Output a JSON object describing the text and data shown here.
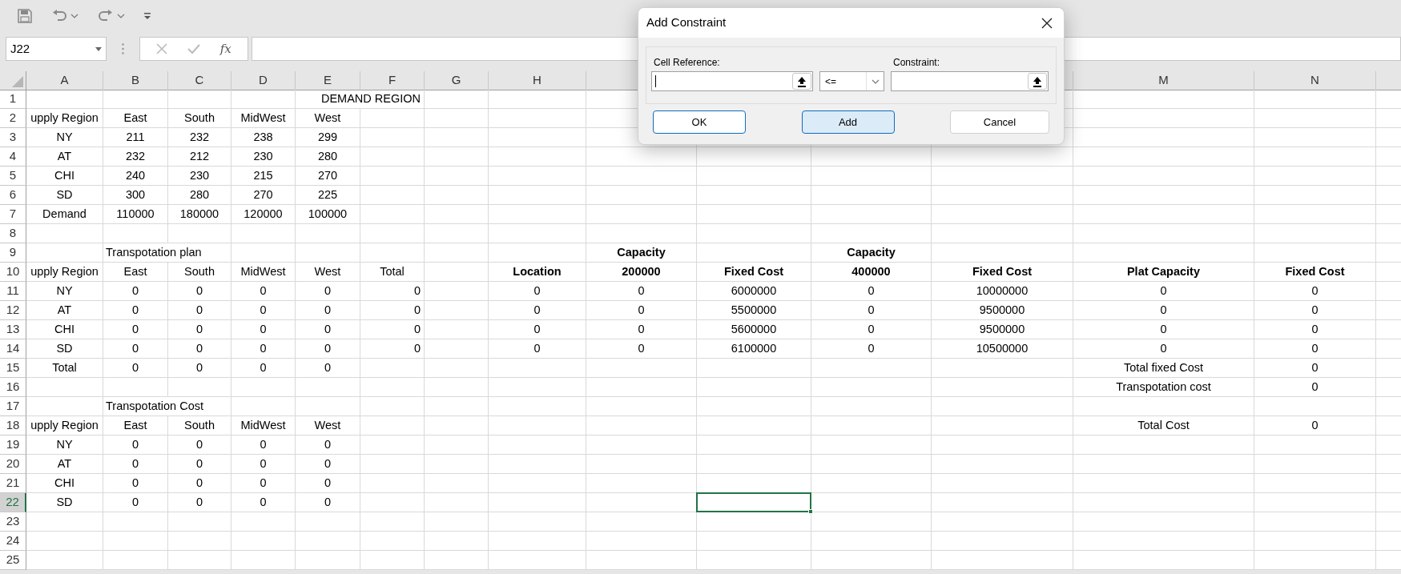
{
  "quick_access": {
    "undo_enabled": true,
    "redo_enabled": true
  },
  "formula_bar": {
    "name_box": "J22",
    "function_button": "fx"
  },
  "column_headers": [
    {
      "label": "A"
    },
    {
      "label": "B"
    },
    {
      "label": "C"
    },
    {
      "label": "D"
    },
    {
      "label": "E"
    },
    {
      "label": "F"
    },
    {
      "label": "G"
    },
    {
      "label": "H"
    },
    {
      "label": "M"
    },
    {
      "label": "N"
    }
  ],
  "rows": [
    {
      "label": "1",
      "selected": false,
      "cells": [
        {},
        {},
        {},
        {},
        {},
        {
          "text": "DEMAND REGION",
          "align_right": true,
          "overflows": true
        }
      ]
    },
    {
      "label": "2",
      "selected": false,
      "cells": [
        {
          "text": "upply Region"
        },
        {
          "text": "East"
        },
        {
          "text": "South"
        },
        {
          "text": "MidWest"
        },
        {
          "text": "West"
        }
      ]
    },
    {
      "label": "3",
      "selected": false,
      "cells": [
        {
          "text": "NY"
        },
        {
          "text": "211"
        },
        {
          "text": "232"
        },
        {
          "text": "238"
        },
        {
          "text": "299"
        }
      ]
    },
    {
      "label": "4",
      "selected": false,
      "cells": [
        {
          "text": "AT"
        },
        {
          "text": "232"
        },
        {
          "text": "212"
        },
        {
          "text": "230"
        },
        {
          "text": "280"
        }
      ]
    },
    {
      "label": "5",
      "selected": false,
      "cells": [
        {
          "text": "CHI"
        },
        {
          "text": "240"
        },
        {
          "text": "230"
        },
        {
          "text": "215"
        },
        {
          "text": "270"
        }
      ]
    },
    {
      "label": "6",
      "selected": false,
      "cells": [
        {
          "text": "SD"
        },
        {
          "text": "300"
        },
        {
          "text": "280"
        },
        {
          "text": "270"
        },
        {
          "text": "225"
        }
      ]
    },
    {
      "label": "7",
      "selected": false,
      "cells": [
        {
          "text": "Demand"
        },
        {
          "text": "110000"
        },
        {
          "text": "180000"
        },
        {
          "text": "120000"
        },
        {
          "text": "100000"
        }
      ]
    },
    {
      "label": "8",
      "selected": false,
      "cells": []
    },
    {
      "label": "9",
      "selected": false,
      "cells": [
        {},
        {
          "text": "Transpotation plan",
          "align_left": true,
          "overflows": true
        },
        {},
        {},
        {},
        {},
        {},
        {},
        {
          "text": "Capacity",
          "bold": true
        },
        {},
        {
          "text": "Capacity",
          "bold": true
        }
      ]
    },
    {
      "label": "10",
      "selected": false,
      "cells": [
        {
          "text": "upply Region"
        },
        {
          "text": "East"
        },
        {
          "text": "South"
        },
        {
          "text": "MidWest"
        },
        {
          "text": "West"
        },
        {
          "text": "Total"
        },
        {},
        {
          "text": "Location",
          "bold": true
        },
        {
          "text": "200000",
          "bold": true
        },
        {
          "text": "Fixed Cost",
          "bold": true
        },
        {
          "text": "400000",
          "bold": true
        },
        {
          "text": "Fixed Cost",
          "bold": true
        },
        {
          "text": "Plat Capacity",
          "bold": true
        },
        {
          "text": "Fixed Cost",
          "bold": true
        }
      ]
    },
    {
      "label": "11",
      "selected": false,
      "cells": [
        {
          "text": "NY"
        },
        {
          "text": "0"
        },
        {
          "text": "0"
        },
        {
          "text": "0"
        },
        {
          "text": "0"
        },
        {
          "text": "0",
          "align_right": true
        },
        {},
        {
          "text": "0"
        },
        {
          "text": "0"
        },
        {
          "text": "6000000"
        },
        {
          "text": "0"
        },
        {
          "text": "10000000"
        },
        {
          "text": "0"
        },
        {
          "text": "0"
        }
      ]
    },
    {
      "label": "12",
      "selected": false,
      "cells": [
        {
          "text": "AT"
        },
        {
          "text": "0"
        },
        {
          "text": "0"
        },
        {
          "text": "0"
        },
        {
          "text": "0"
        },
        {
          "text": "0",
          "align_right": true
        },
        {},
        {
          "text": "0"
        },
        {
          "text": "0"
        },
        {
          "text": "5500000"
        },
        {
          "text": "0"
        },
        {
          "text": "9500000"
        },
        {
          "text": "0"
        },
        {
          "text": "0"
        }
      ]
    },
    {
      "label": "13",
      "selected": false,
      "cells": [
        {
          "text": "CHI"
        },
        {
          "text": "0"
        },
        {
          "text": "0"
        },
        {
          "text": "0"
        },
        {
          "text": "0"
        },
        {
          "text": "0",
          "align_right": true
        },
        {},
        {
          "text": "0"
        },
        {
          "text": "0"
        },
        {
          "text": "5600000"
        },
        {
          "text": "0"
        },
        {
          "text": "9500000"
        },
        {
          "text": "0"
        },
        {
          "text": "0"
        }
      ]
    },
    {
      "label": "14",
      "selected": false,
      "cells": [
        {
          "text": "SD"
        },
        {
          "text": "0"
        },
        {
          "text": "0"
        },
        {
          "text": "0"
        },
        {
          "text": "0"
        },
        {
          "text": "0",
          "align_right": true
        },
        {},
        {
          "text": "0"
        },
        {
          "text": "0"
        },
        {
          "text": "6100000"
        },
        {
          "text": "0"
        },
        {
          "text": "10500000"
        },
        {
          "text": "0"
        },
        {
          "text": "0"
        }
      ]
    },
    {
      "label": "15",
      "selected": false,
      "cells": [
        {
          "text": "Total"
        },
        {
          "text": "0"
        },
        {
          "text": "0"
        },
        {
          "text": "0"
        },
        {
          "text": "0"
        },
        {},
        {},
        {},
        {},
        {},
        {},
        {},
        {
          "text": "Total fixed Cost"
        },
        {
          "text": "0"
        }
      ]
    },
    {
      "label": "16",
      "selected": false,
      "cells": [
        {},
        {},
        {},
        {},
        {},
        {},
        {},
        {},
        {},
        {},
        {},
        {},
        {
          "text": "Transpotation cost"
        },
        {
          "text": "0"
        }
      ]
    },
    {
      "label": "17",
      "selected": false,
      "cells": [
        {},
        {
          "text": "Transpotation Cost",
          "align_left": true,
          "overflows": true
        }
      ]
    },
    {
      "label": "18",
      "selected": false,
      "cells": [
        {
          "text": "upply Region"
        },
        {
          "text": "East"
        },
        {
          "text": "South"
        },
        {
          "text": "MidWest"
        },
        {
          "text": "West"
        },
        {},
        {},
        {},
        {},
        {},
        {},
        {},
        {
          "text": "Total Cost"
        },
        {
          "text": "0"
        }
      ]
    },
    {
      "label": "19",
      "selected": false,
      "cells": [
        {
          "text": "NY"
        },
        {
          "text": "0"
        },
        {
          "text": "0"
        },
        {
          "text": "0"
        },
        {
          "text": "0"
        }
      ]
    },
    {
      "label": "20",
      "selected": false,
      "cells": [
        {
          "text": "AT"
        },
        {
          "text": "0"
        },
        {
          "text": "0"
        },
        {
          "text": "0"
        },
        {
          "text": "0"
        }
      ]
    },
    {
      "label": "21",
      "selected": false,
      "cells": [
        {
          "text": "CHI"
        },
        {
          "text": "0"
        },
        {
          "text": "0"
        },
        {
          "text": "0"
        },
        {
          "text": "0"
        }
      ]
    },
    {
      "label": "22",
      "selected": true,
      "cells": [
        {
          "text": "SD"
        },
        {
          "text": "0"
        },
        {
          "text": "0"
        },
        {
          "text": "0"
        },
        {
          "text": "0"
        },
        {},
        {},
        {},
        {},
        {
          "active": true
        }
      ]
    },
    {
      "label": "23",
      "selected": false,
      "cells": []
    },
    {
      "label": "24",
      "selected": false,
      "cells": []
    },
    {
      "label": "25",
      "selected": false,
      "cells": []
    }
  ],
  "dialog": {
    "title": "Add Constraint",
    "cell_reference": {
      "label": "Cell Reference:",
      "focused": true
    },
    "operator": {
      "value": "<="
    },
    "constraint": {
      "label": "Constraint:"
    },
    "buttons": [
      {
        "label": "OK",
        "highlighted": true,
        "default": false
      },
      {
        "label": "Add",
        "highlighted": true,
        "default": true
      },
      {
        "label": "Cancel",
        "highlighted": false,
        "default": false
      }
    ]
  }
}
